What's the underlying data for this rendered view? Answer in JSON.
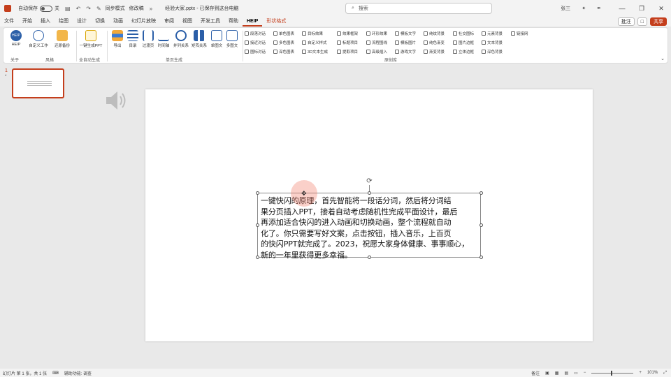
{
  "titlebar": {
    "autosave_label": "自动保存",
    "autosave_state": "关",
    "quick_access": [
      "同步模式",
      "修改稿"
    ],
    "doc_title": "经验大家.pptx - 已保存到这台电脑",
    "search_placeholder": "搜索",
    "user": "张三",
    "window_controls": [
      "—",
      "❐",
      "✕"
    ]
  },
  "tabs": [
    {
      "label": "文件"
    },
    {
      "label": "开始"
    },
    {
      "label": "插入"
    },
    {
      "label": "绘图"
    },
    {
      "label": "设计"
    },
    {
      "label": "切换"
    },
    {
      "label": "动画"
    },
    {
      "label": "幻灯片放映"
    },
    {
      "label": "审阅"
    },
    {
      "label": "视图"
    },
    {
      "label": "开发工具"
    },
    {
      "label": "帮助"
    },
    {
      "label": "HEIP"
    },
    {
      "label": "形状格式"
    }
  ],
  "tab_actions": {
    "comments": "批注",
    "present": "□",
    "share": "共享"
  },
  "ribbon": {
    "buttons": [
      {
        "label": "HEIP"
      },
      {
        "label": "自定义工作"
      },
      {
        "label": "还原备份"
      },
      {
        "label": "一键生成PPT"
      },
      {
        "label": "导出"
      },
      {
        "label": "目录"
      },
      {
        "label": "过渡页"
      },
      {
        "label": "时间轴"
      },
      {
        "label": "并列关系"
      },
      {
        "label": "矩阵关系"
      },
      {
        "label": "单图文"
      },
      {
        "label": "多图文"
      }
    ],
    "groups": [
      "关于",
      "风格",
      "全自动生成",
      "单页生成",
      "原创库"
    ],
    "grid": [
      [
        "段落对话",
        "单色图表",
        "目标效果",
        "效果框架",
        "环形效果",
        "模板文字",
        "纯纹背景",
        "社交图标",
        "元素背景",
        "链接网"
      ],
      [
        "接近对话",
        "多色图表",
        "自定义样式",
        "标题项目",
        "流程图线",
        "模板图片",
        "纯色渐变",
        "图片边框",
        "文本背景"
      ],
      [
        "图标对话",
        "深色图表",
        "3D文本生成",
        "提取项目",
        "高级插入",
        "游戏文字",
        "渐变背景",
        "立体边框",
        "深色背景"
      ]
    ]
  },
  "thumbnails": {
    "slide_number": "1",
    "star": "*"
  },
  "slide": {
    "textbox_lines": [
      "一键快闪的原理，首先智能将一段话分词，然后将分词结",
      "果分页插入PPT，接着自动考虑随机性完成平面设计，最后",
      "再添加适合快闪的进入动画和切换动画，整个流程就自动",
      "化了。你只需要写好文案，点击按钮，插入音乐，上百页",
      "的快闪PPT就完成了。2023，祝愿大家身体健康、事事顺心，",
      "新的一年里获得更多幸福。"
    ]
  },
  "statusbar": {
    "slide_info": "幻灯片 第 1 张，共 1 张",
    "accessibility": "辅助功能: 调查",
    "notes": "备注",
    "zoom": "101%"
  },
  "colors": {
    "accent": "#c43e1c",
    "selection": "#8a8a8a"
  }
}
